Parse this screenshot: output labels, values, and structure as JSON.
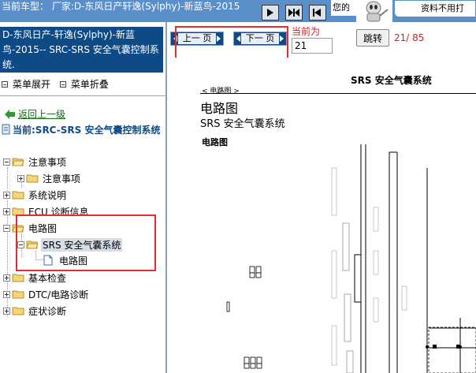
{
  "topbar": {
    "title": "当前车型：  厂家:D-东风日产轩逸(Sylphy)-新蓝鸟-2015",
    "tip1": "您的",
    "tip2": "资料不用打"
  },
  "sidebar": {
    "vehicle": "D-东风日产-轩逸(Sylphy)-新蓝鸟-2015-- SRC-SRS 安全气囊控制系统.",
    "expand_label": "菜单展开",
    "collapse_label": "菜单折叠",
    "back_label": "返回上一级",
    "current_label": "当前:SRC-SRS 安全气囊控制系统",
    "tree": [
      {
        "label": "注意事项"
      },
      {
        "label": "注意事项"
      },
      {
        "label": "系统说明"
      },
      {
        "label": "ECU 诊断信息"
      },
      {
        "label": "电路图"
      },
      {
        "label": "SRS 安全气囊系统"
      },
      {
        "label": "电路图"
      },
      {
        "label": "基本检查"
      },
      {
        "label": "DTC/电路诊断"
      },
      {
        "label": "症状诊断"
      }
    ]
  },
  "pager": {
    "prev_label": "上一 页",
    "next_label": "下一 页",
    "current_label": "当前为",
    "current_page": "21",
    "jump_label": "跳转",
    "page_count": "21/ 85"
  },
  "document": {
    "header": "SRS 安全气囊系统",
    "breadcrumb": "< 电路图 >",
    "title": "电路图",
    "subtitle": "SRS 安全气囊系统",
    "section": "电路图"
  },
  "colors": {
    "topbar": "#5b8fc9",
    "vehicle_bg": "#0e4a85",
    "highlight_box": "#e02d2d",
    "page_count": "#d02020"
  }
}
